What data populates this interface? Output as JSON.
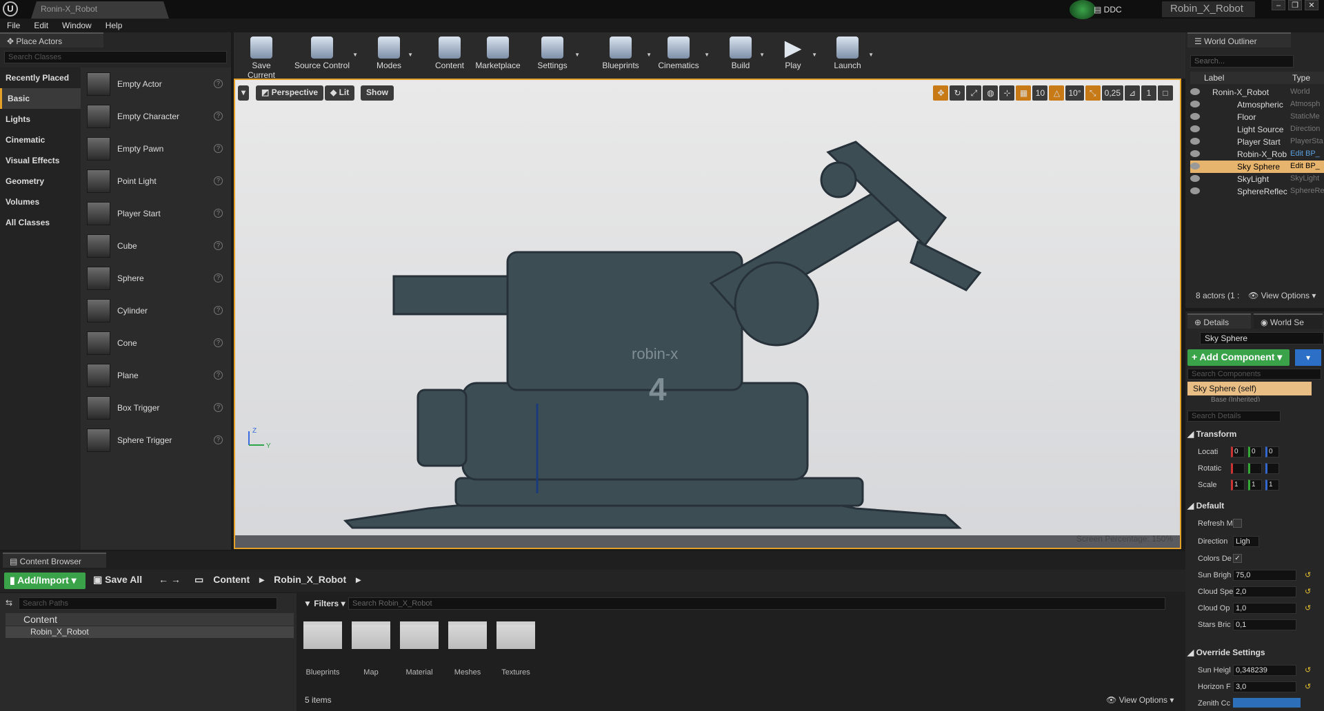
{
  "window": {
    "doc_tab": "Ronin-X_Robot",
    "ddc": "DDC",
    "project_name": "Robin_X_Robot",
    "controls": [
      "–",
      "❐",
      "✕"
    ]
  },
  "menu": [
    "File",
    "Edit",
    "Window",
    "Help"
  ],
  "place_actors": {
    "tab_label": "Place Actors",
    "search_placeholder": "Search Classes",
    "categories": [
      "Recently Placed",
      "Basic",
      "Lights",
      "Cinematic",
      "Visual Effects",
      "Geometry",
      "Volumes",
      "All Classes"
    ],
    "active_category": "Basic",
    "items": [
      "Empty Actor",
      "Empty Character",
      "Empty Pawn",
      "Point Light",
      "Player Start",
      "Cube",
      "Sphere",
      "Cylinder",
      "Cone",
      "Plane",
      "Box Trigger",
      "Sphere Trigger"
    ]
  },
  "toolbar": [
    "Save Current",
    "Source Control",
    "Modes",
    "Content",
    "Marketplace",
    "Settings",
    "Blueprints",
    "Cinematics",
    "Build",
    "Play",
    "Launch"
  ],
  "viewport": {
    "perspective": "Perspective",
    "lit": "Lit",
    "show": "Show",
    "grid_snap": "10",
    "rot_snap": "10°",
    "scale_snap": "0,25",
    "cam_speed": "1",
    "screen_percentage": "Screen Percentage:",
    "screen_percentage_value": "150%",
    "robot_text": "robin-x",
    "robot_number": "4",
    "axis_z": "Z",
    "axis_y": "Y"
  },
  "outliner": {
    "tab_label": "World Outliner",
    "search_placeholder": "Search...",
    "col_label": "Label",
    "col_type": "Type",
    "rows": [
      {
        "name": "Ronin-X_Robot",
        "type": "World"
      },
      {
        "name": "Atmospheric",
        "type": "Atmosph"
      },
      {
        "name": "Floor",
        "type": "StaticMe"
      },
      {
        "name": "Light Source",
        "type": "Direction"
      },
      {
        "name": "Player Start",
        "type": "PlayerSta"
      },
      {
        "name": "Robin-X_Rob",
        "type": "Edit BP_"
      },
      {
        "name": "Sky Sphere",
        "type": "Edit BP_"
      },
      {
        "name": "SkyLight",
        "type": "SkyLight"
      },
      {
        "name": "SphereReflec",
        "type": "SphereRe"
      }
    ],
    "actors_count": "8 actors (1 :",
    "view_options": "View Options"
  },
  "details": {
    "tab_details": "Details",
    "tab_world": "World Se",
    "object_name": "Sky Sphere",
    "add_component": "+ Add Component",
    "search_components": "Search Components",
    "self_component": "Sky Sphere (self)",
    "inherited": "Base (Inherited)",
    "search_details": "Search Details",
    "transform": "Transform",
    "location": "Locati",
    "rotation": "Rotatic",
    "scale": "Scale",
    "loc_vals": [
      "0",
      "0",
      "0"
    ],
    "scale_vals": [
      "1",
      "1",
      "1"
    ],
    "default": "Default",
    "refresh": "Refresh M",
    "direction": "Direction",
    "direction_val": "Ligh",
    "colors": "Colors De",
    "sun_bright": "Sun Brigh",
    "sun_bright_val": "75,0",
    "cloud_speed": "Cloud Spe",
    "cloud_speed_val": "2,0",
    "cloud_opacity": "Cloud Op",
    "cloud_opacity_val": "1,0",
    "stars": "Stars Bric",
    "stars_val": "0,1",
    "override": "Override Settings",
    "sun_height": "Sun Heigl",
    "sun_height_val": "0,348239",
    "horizon": "Horizon F",
    "horizon_val": "3,0",
    "zenith": "Zenith Cc"
  },
  "content_browser": {
    "tab_label": "Content Browser",
    "add_import": "Add/Import",
    "save_all": "Save All",
    "crumbs": [
      "Content",
      "Robin_X_Robot"
    ],
    "search_paths": "Search Paths",
    "tree_content": "Content",
    "tree_robin": "Robin_X_Robot",
    "filters": "Filters",
    "search_assets": "Search Robin_X_Robot",
    "folders": [
      "Blueprints",
      "Map",
      "Material",
      "Meshes",
      "Textures"
    ],
    "items_count": "5 items",
    "view_options": "View Options"
  }
}
